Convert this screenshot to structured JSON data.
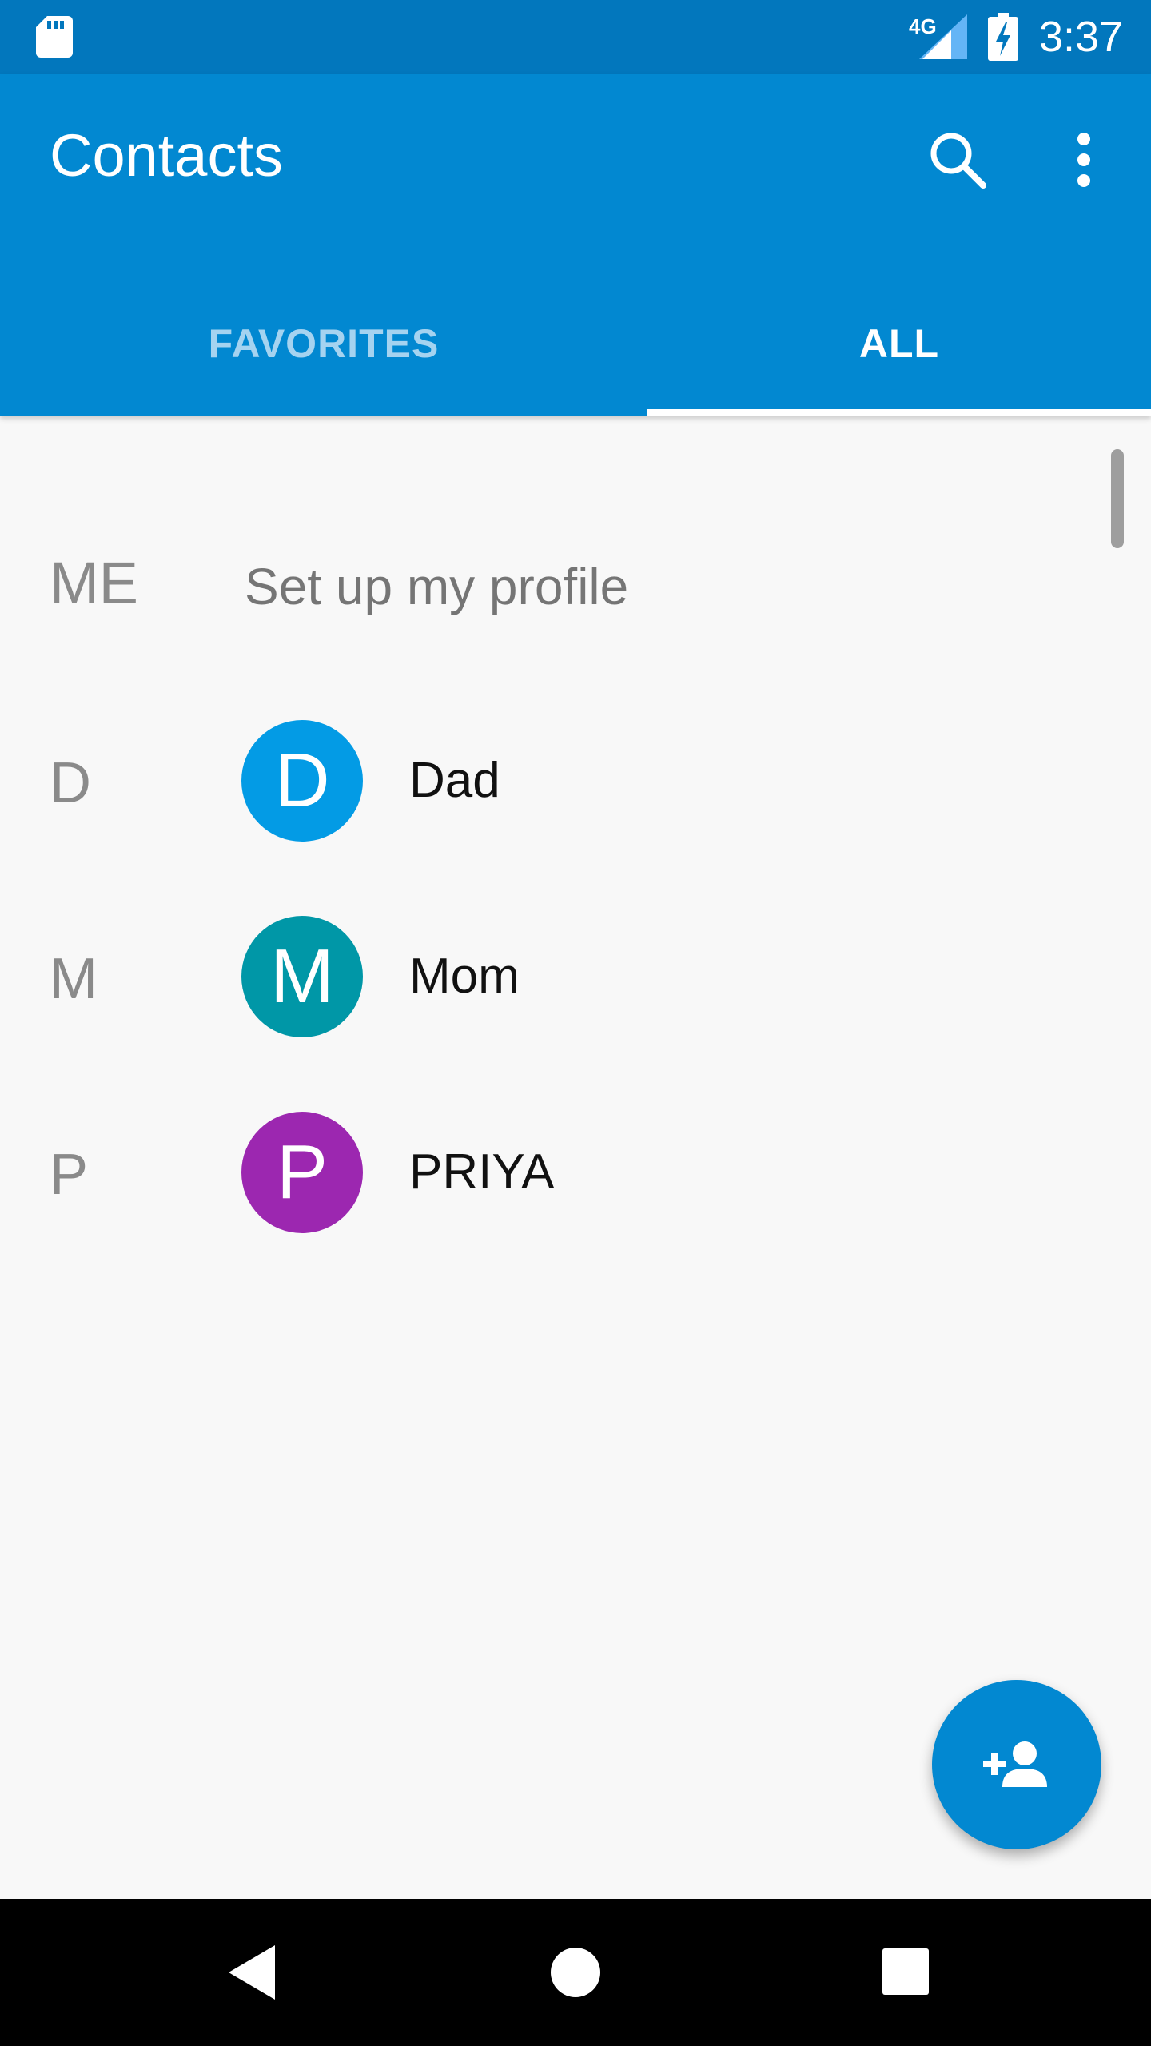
{
  "status_bar": {
    "network": "4G",
    "time": "3:37",
    "icons": [
      "sd-card-icon",
      "signal-icon",
      "battery-charging-icon"
    ]
  },
  "toolbar": {
    "title": "Contacts",
    "icons": [
      "search-icon",
      "more-vert-icon"
    ]
  },
  "tabs": [
    {
      "label": "FAVORITES",
      "selected": false
    },
    {
      "label": "ALL",
      "selected": true
    }
  ],
  "me": {
    "label": "ME",
    "text": "Set up my profile"
  },
  "contacts": [
    {
      "section": "D",
      "initial": "D",
      "name": "Dad",
      "color": "#039be5"
    },
    {
      "section": "M",
      "initial": "M",
      "name": "Mom",
      "color": "#0097a7"
    },
    {
      "section": "P",
      "initial": "P",
      "name": "PRIYA",
      "color": "#9c27b0"
    }
  ],
  "fab": {
    "icon": "person-add-icon"
  },
  "nav_bar": {
    "icons": [
      "back-icon",
      "home-icon",
      "recents-icon"
    ]
  },
  "colors": {
    "status_bar": "#0277bd",
    "toolbar": "#0288d1",
    "background": "#f8f8f8",
    "accent": "#0288d1"
  }
}
